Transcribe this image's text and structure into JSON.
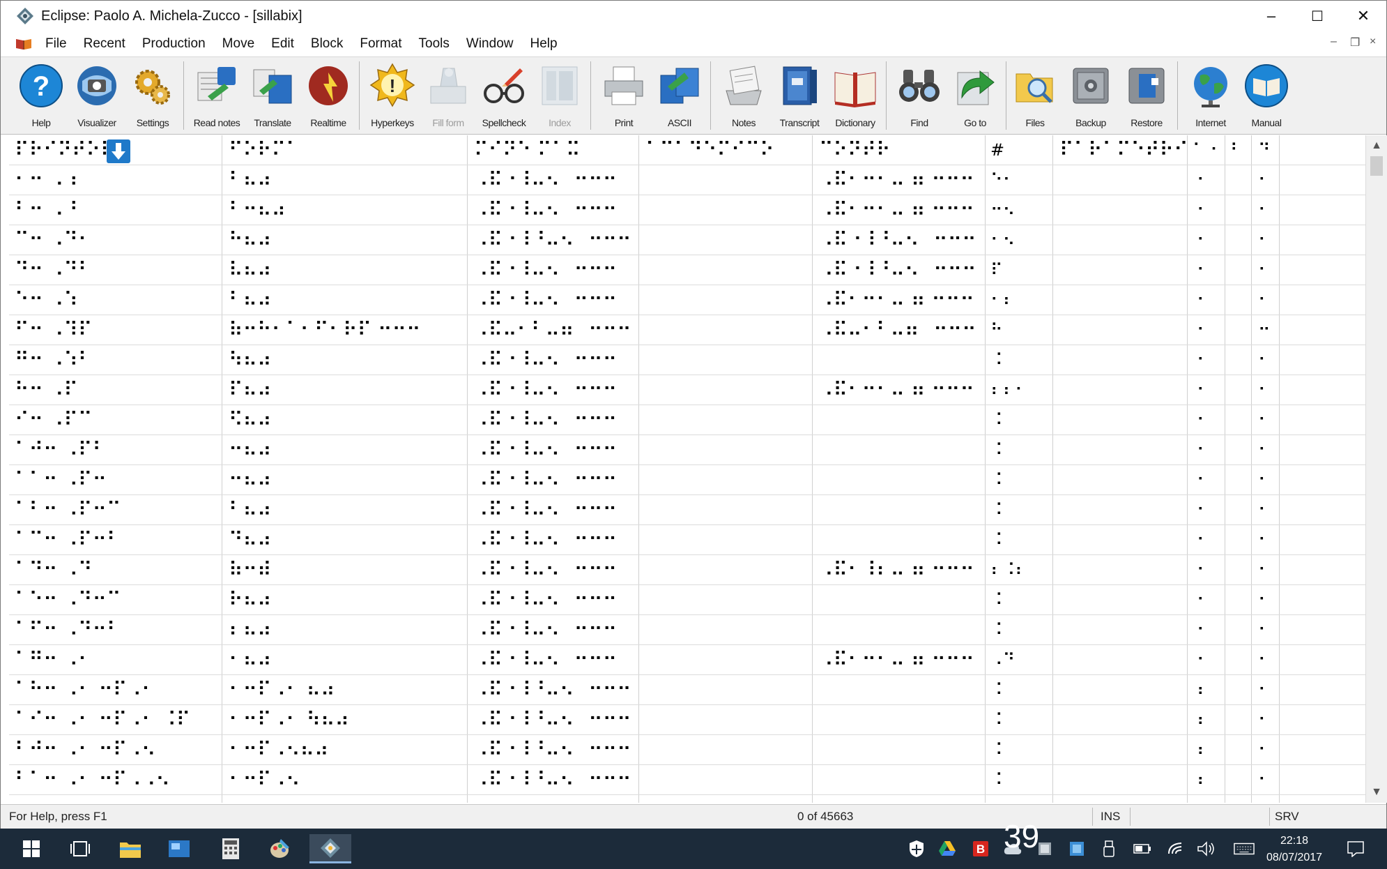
{
  "window": {
    "title": "Eclipse: Paolo A. Michela-Zucco - [sillabix]",
    "controls": {
      "minimize": "–",
      "maximize": "☐",
      "close": "✕"
    }
  },
  "menubar": {
    "items": [
      "File",
      "Recent",
      "Production",
      "Move",
      "Edit",
      "Block",
      "Format",
      "Tools",
      "Window",
      "Help"
    ],
    "mdi": {
      "minimize": "–",
      "restore": "❐",
      "close": "×"
    }
  },
  "toolbar": {
    "buttons": [
      {
        "label": "Help",
        "icon": "help-icon",
        "enabled": true
      },
      {
        "label": "Visualizer",
        "icon": "visualizer-icon",
        "enabled": true
      },
      {
        "label": "Settings",
        "icon": "settings-gears-icon",
        "enabled": true
      },
      {
        "label": "Read notes",
        "icon": "read-notes-icon",
        "enabled": true
      },
      {
        "label": "Translate",
        "icon": "translate-icon",
        "enabled": true
      },
      {
        "label": "Realtime",
        "icon": "realtime-icon",
        "enabled": true
      },
      {
        "label": "Hyperkeys",
        "icon": "hyperkeys-icon",
        "enabled": true
      },
      {
        "label": "Fill form",
        "icon": "fill-form-icon",
        "enabled": false
      },
      {
        "label": "Spellcheck",
        "icon": "spellcheck-icon",
        "enabled": true
      },
      {
        "label": "Index",
        "icon": "index-icon",
        "enabled": false
      },
      {
        "label": "Print",
        "icon": "printer-icon",
        "enabled": true
      },
      {
        "label": "ASCII",
        "icon": "ascii-icon",
        "enabled": true
      },
      {
        "label": "Notes",
        "icon": "notes-icon",
        "enabled": true
      },
      {
        "label": "Transcript",
        "icon": "transcript-icon",
        "enabled": true
      },
      {
        "label": "Dictionary",
        "icon": "dictionary-icon",
        "enabled": true
      },
      {
        "label": "Find",
        "icon": "binoculars-icon",
        "enabled": true
      },
      {
        "label": "Go to",
        "icon": "goto-arrow-icon",
        "enabled": true
      },
      {
        "label": "Files",
        "icon": "folder-search-icon",
        "enabled": true
      },
      {
        "label": "Backup",
        "icon": "backup-safe-icon",
        "enabled": true
      },
      {
        "label": "Restore",
        "icon": "restore-icon",
        "enabled": true
      },
      {
        "label": "Internet",
        "icon": "globe-icon",
        "enabled": true
      },
      {
        "label": "Manual",
        "icon": "manual-icon",
        "enabled": true
      }
    ]
  },
  "grid": {
    "header": [
      "⠏⠗⠊⠝⠞⠕⠗",
      "⠋⠕⠗⠍⠁",
      "⠍⠊⠝⠑ ⠍⠁⠭",
      "⠁⠉⠁⠙⠑⠍⠊⠉⠕",
      "⠉⠕⠝⠞⠗",
      "#",
      "⠏⠁⠗⠁⠍⠑⠞⠗⠊",
      "⠁ ⠂",
      "⠃",
      "⠙"
    ],
    "rows": [
      [
        "⠂⠒ ⠠⠰",
        "⠃⠦⠴",
        "⠠⠯⠐⠸⠤⠢⠀⠒⠒⠒",
        "",
        "⠠⠯⠂⠒⠂⠤ ⠶ ⠒⠒⠒",
        "⠑⠂",
        "⠂",
        "⠂"
      ],
      [
        "⠃⠒ ⠠⠘",
        "⠃⠒⠦⠴",
        "⠠⠯⠐⠸⠤⠢⠀⠒⠒⠒",
        "",
        "⠠⠯⠂⠒⠂⠤ ⠶ ⠒⠒⠒",
        "⠒⠢",
        "⠂",
        "⠂"
      ],
      [
        "⠉⠒ ⠠⠙⠂",
        "⠓⠦⠴",
        "⠠⠯⠐⠸⠘⠤⠢⠀⠒⠒⠒",
        "",
        "⠠⠯⠐⠸⠘⠤⠢⠀⠒⠒⠒",
        "⠂⠢",
        "⠂",
        "⠂"
      ],
      [
        "⠙⠒ ⠠⠙⠃",
        "⠧⠦⠴",
        "⠠⠯⠐⠸⠤⠢⠀⠒⠒⠒",
        "",
        "⠠⠯⠐⠸⠘⠤⠢⠀⠒⠒⠒",
        "⠏",
        "⠂",
        "⠂"
      ],
      [
        "⠑⠒ ⠠⠱",
        "⠃⠦⠴",
        "⠠⠯⠐⠸⠤⠢⠀⠒⠒⠒",
        "",
        "⠠⠯⠂⠒⠂⠤ ⠶ ⠒⠒⠒",
        "⠂⠆",
        "⠂",
        "⠂"
      ],
      [
        "⠋⠒ ⠠⠹⠏",
        "⠷⠒⠓⠂⠁⠂⠋⠂⠗⠏ ⠒⠒⠒",
        "⠠⠯⠤⠂⠃⠤⠶⠀⠒⠒⠒",
        "",
        "⠠⠯⠤⠂⠃⠤⠶⠀⠒⠒⠒",
        "⠓",
        "⠂",
        "⠒"
      ],
      [
        "⠛⠒ ⠠⠱⠃",
        "⠳⠦⠴",
        "⠠⠯⠐⠸⠤⠢⠀⠒⠒⠒",
        "",
        "",
        "⠨",
        "⠂",
        "⠂"
      ],
      [
        "⠓⠒ ⠠⠏",
        "⠏⠦⠴",
        "⠠⠯⠐⠸⠤⠢⠀⠒⠒⠒",
        "",
        "⠠⠯⠂⠒⠂⠤ ⠶ ⠒⠒⠒",
        "⠆⠆⠂",
        "⠂",
        "⠂"
      ],
      [
        "⠊⠒ ⠠⠏⠉",
        "⠫⠦⠴",
        "⠠⠯⠐⠸⠤⠢⠀⠒⠒⠒",
        "",
        "",
        "⠨",
        "⠂",
        "⠂"
      ],
      [
        "⠁⠚⠒ ⠠⠏⠃",
        "⠒⠦⠴",
        "⠠⠯⠐⠸⠤⠢⠀⠒⠒⠒",
        "",
        "",
        "⠨",
        "⠂",
        "⠂"
      ],
      [
        "⠁⠁⠒ ⠠⠏⠒",
        "⠒⠦⠴",
        "⠠⠯⠐⠸⠤⠢⠀⠒⠒⠒",
        "",
        "",
        "⠨",
        "⠂",
        "⠂"
      ],
      [
        "⠁⠃⠒ ⠠⠏⠒⠉",
        "⠃⠦⠴",
        "⠠⠯⠐⠸⠤⠢⠀⠒⠒⠒",
        "",
        "",
        "⠨",
        "⠂",
        "⠂"
      ],
      [
        "⠁⠉⠒ ⠠⠏⠒⠃",
        "⠙⠦⠴",
        "⠠⠯⠐⠸⠤⠢⠀⠒⠒⠒",
        "",
        "",
        "⠨",
        "⠂",
        "⠂"
      ],
      [
        "⠁⠙⠒ ⠠⠙",
        "⠷⠒⠾",
        "⠠⠯⠐⠸⠤⠢⠀⠒⠒⠒",
        "",
        "⠠⠯⠂⠸⠆⠤ ⠶ ⠒⠒⠒",
        "⠆⠨⠆",
        "⠂",
        "⠂"
      ],
      [
        "⠁⠑⠒ ⠠⠙⠒⠉",
        "⠗⠦⠴",
        "⠠⠯⠐⠸⠤⠢⠀⠒⠒⠒",
        "",
        "",
        "⠨",
        "⠂",
        "⠂"
      ],
      [
        "⠁⠋⠒ ⠠⠙⠒⠃",
        "⠆⠦⠴",
        "⠠⠯⠐⠸⠤⠢⠀⠒⠒⠒",
        "",
        "",
        "⠨",
        "⠂",
        "⠂"
      ],
      [
        "⠁⠛⠒ ⠠⠂",
        "⠂⠦⠴",
        "⠠⠯⠐⠸⠤⠢⠀⠒⠒⠒",
        "",
        "⠠⠯⠂⠒⠂⠤ ⠶ ⠒⠒⠒",
        "⠠⠙",
        "⠂",
        "⠂"
      ],
      [
        "⠁⠓⠒ ⠠⠂ ⠒⠏⠠⠂",
        "⠂⠒⠏⠠⠂ ⠦⠴",
        "⠠⠯⠐⠸⠘⠤⠢⠀⠒⠒⠒",
        "",
        "",
        "⠨",
        "⠆",
        "⠂"
      ],
      [
        "⠁⠊⠒ ⠠⠂ ⠒⠏⠠⠂ ⠨⠏",
        "⠂⠒⠏⠠⠂ ⠳⠦⠴",
        "⠠⠯⠐⠸⠘⠤⠢⠀⠒⠒⠒",
        "",
        "",
        "⠨",
        "⠆",
        "⠂"
      ],
      [
        "⠃⠚⠒ ⠠⠂ ⠒⠏⠠⠢",
        "⠂⠒⠏⠠⠢⠦⠴",
        "⠠⠯⠐⠸⠘⠤⠢⠀⠒⠒⠒",
        "",
        "",
        "⠨",
        "⠆",
        "⠂"
      ],
      [
        "⠃⠁⠒ ⠠⠂ ⠒⠏⠠⠠⠢",
        "⠂⠒⠏⠠⠢",
        "⠠⠯⠐⠸⠘⠤⠢⠀⠒⠒⠒",
        "",
        "",
        "⠨",
        "⠆",
        "⠂"
      ]
    ]
  },
  "status": {
    "help": "For Help, press F1",
    "position": "0 of 45663",
    "mode": "INS",
    "flag": "SRV"
  },
  "taskbar": {
    "items": [
      {
        "icon": "windows-start-icon"
      },
      {
        "icon": "task-view-icon"
      },
      {
        "icon": "file-explorer-icon"
      },
      {
        "icon": "photo-viewer-icon"
      },
      {
        "icon": "calculator-icon"
      },
      {
        "icon": "paint-icon"
      },
      {
        "icon": "eclipse-app-icon",
        "active": true
      }
    ],
    "tray": [
      {
        "icon": "security-shield-icon"
      },
      {
        "icon": "google-drive-icon"
      },
      {
        "icon": "b-app-icon"
      },
      {
        "icon": "cloud-icon"
      },
      {
        "icon": "device-icon"
      },
      {
        "icon": "network-app-icon"
      },
      {
        "icon": "usb-icon"
      },
      {
        "icon": "battery-icon"
      },
      {
        "icon": "wifi-icon"
      },
      {
        "icon": "volume-icon"
      },
      {
        "icon": "keyboard-icon"
      },
      {
        "icon": "notifications-icon"
      }
    ],
    "time": "22:18",
    "date": "08/07/2017",
    "overlay": "39"
  }
}
